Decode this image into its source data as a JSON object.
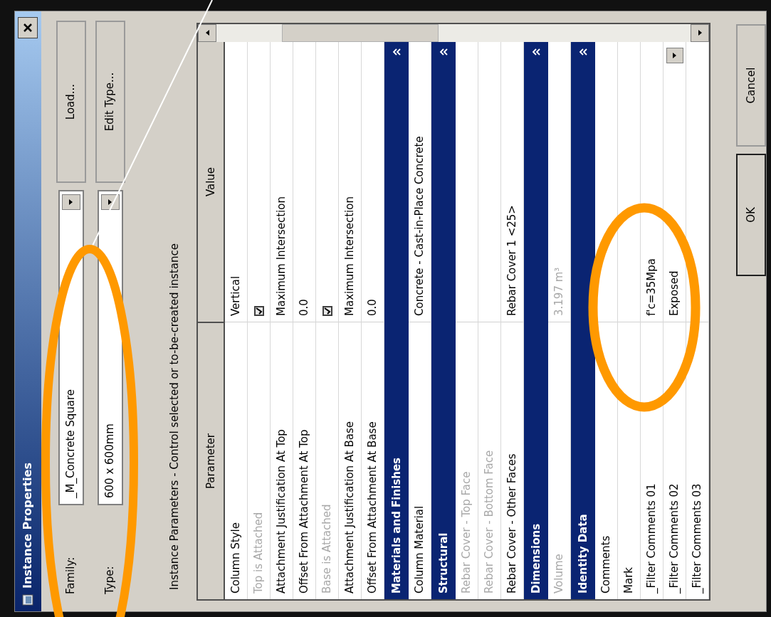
{
  "window": {
    "title": "Instance Properties"
  },
  "family": {
    "label": "Family:",
    "value": "_M_Concrete Square"
  },
  "type": {
    "label": "Type:",
    "value": "600 x 600mm"
  },
  "side_buttons": [
    "Load...",
    "Edit Type..."
  ],
  "instance_label": "Instance Parameters - Control selected or to-be-created instance",
  "table": {
    "columns": [
      "Parameter",
      "Value"
    ],
    "rows": [
      {
        "kind": "param",
        "name": "Column Style",
        "value": "Vertical",
        "disabled": false,
        "dropdown": false
      },
      {
        "kind": "check",
        "name": "Top is Attached",
        "checked": true,
        "disabled": true
      },
      {
        "kind": "param",
        "name": "Attachment Justification At Top",
        "value": "Maximum Intersection",
        "disabled": false,
        "dropdown": false
      },
      {
        "kind": "param",
        "name": "Offset From Attachment At Top",
        "value": "0.0",
        "disabled": false,
        "dropdown": false
      },
      {
        "kind": "check",
        "name": "Base is Attached",
        "checked": true,
        "disabled": true
      },
      {
        "kind": "param",
        "name": "Attachment Justification At Base",
        "value": "Maximum Intersection",
        "disabled": false,
        "dropdown": false
      },
      {
        "kind": "param",
        "name": "Offset From Attachment At Base",
        "value": "0.0",
        "disabled": false,
        "dropdown": false
      },
      {
        "kind": "group",
        "name": "Materials and Finishes",
        "expanded": true
      },
      {
        "kind": "param",
        "name": "Column Material",
        "value": "Concrete - Cast-in-Place Concrete",
        "disabled": false,
        "dropdown": false
      },
      {
        "kind": "group",
        "name": "Structural",
        "expanded": true
      },
      {
        "kind": "param",
        "name": "Rebar Cover - Top Face",
        "disabled": true,
        "dropdown": false
      },
      {
        "kind": "param",
        "name": "Rebar Cover - Bottom Face",
        "disabled": true,
        "dropdown": false
      },
      {
        "kind": "param",
        "name": "Rebar Cover - Other Faces",
        "value": "Rebar Cover 1 <25>",
        "disabled": false,
        "dropdown": false
      },
      {
        "kind": "group",
        "name": "Dimensions",
        "expanded": true
      },
      {
        "kind": "param",
        "name": "Volume",
        "value": "3.197 m³",
        "disabled": true,
        "dropdown": false
      },
      {
        "kind": "group",
        "name": "Identity Data",
        "expanded": true
      },
      {
        "kind": "param",
        "name": "Comments",
        "disabled": false,
        "dropdown": false
      },
      {
        "kind": "param",
        "name": "Mark",
        "disabled": false,
        "dropdown": false
      },
      {
        "kind": "param",
        "name": "_Filter Comments 01",
        "value": "f'c=35Mpa",
        "disabled": false,
        "dropdown": false
      },
      {
        "kind": "param",
        "name": "_Filter Comments 02",
        "value": "Exposed",
        "disabled": false,
        "dropdown": true
      },
      {
        "kind": "param",
        "name": "_Filter Comments 03",
        "disabled": false,
        "dropdown": false
      }
    ]
  },
  "buttons": [
    "OK",
    "Cancel"
  ]
}
